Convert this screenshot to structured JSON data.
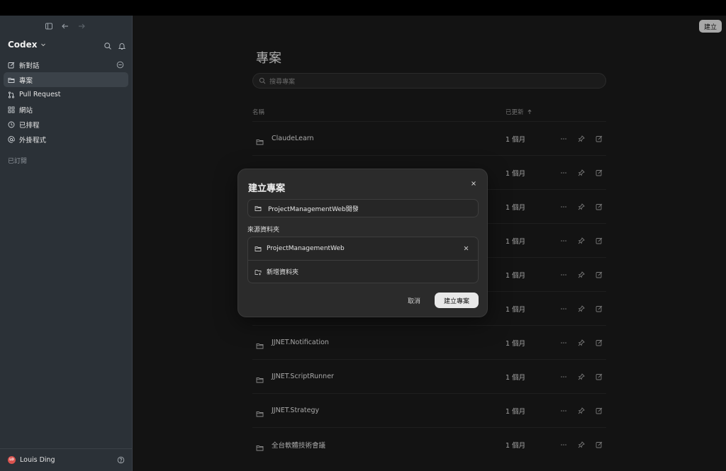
{
  "sidebar": {
    "app_title": "Codex",
    "nav": [
      {
        "label": "新對話",
        "icon": "compose-icon"
      },
      {
        "label": "專案",
        "icon": "folder-icon"
      },
      {
        "label": "Pull Request",
        "icon": "pull-request-icon"
      },
      {
        "label": "網站",
        "icon": "grid-icon"
      },
      {
        "label": "已排程",
        "icon": "clock-icon"
      },
      {
        "label": "外掛程式",
        "icon": "at-icon"
      }
    ],
    "active_index": 1,
    "section_label": "已訂閱",
    "user": {
      "name": "Louis Ding",
      "initials": "LD"
    }
  },
  "header": {
    "create_label": "建立"
  },
  "main": {
    "title": "專案",
    "search_placeholder": "搜尋專案",
    "columns": {
      "name": "名稱",
      "updated": "已更新"
    },
    "rows": [
      {
        "name": "ClaudeLearn",
        "updated": "1 個月"
      },
      {
        "name": "",
        "updated": "1 個月"
      },
      {
        "name": "",
        "updated": "1 個月"
      },
      {
        "name": "",
        "updated": "1 個月"
      },
      {
        "name": "",
        "updated": "1 個月"
      },
      {
        "name": "",
        "updated": "1 個月"
      },
      {
        "name": "JJNET.Notification",
        "updated": "1 個月"
      },
      {
        "name": "JJNET.ScriptRunner",
        "updated": "1 個月"
      },
      {
        "name": "JJNET.Strategy",
        "updated": "1 個月"
      },
      {
        "name": "全台軟體技術會議",
        "updated": "1 個月"
      }
    ]
  },
  "modal": {
    "title": "建立專案",
    "name_value": "ProjectManagementWeb開發",
    "source_label": "來源資料夾",
    "source_folder": "ProjectManagementWeb",
    "add_folder_label": "新增資料夾",
    "cancel_label": "取消",
    "confirm_label": "建立專案"
  }
}
